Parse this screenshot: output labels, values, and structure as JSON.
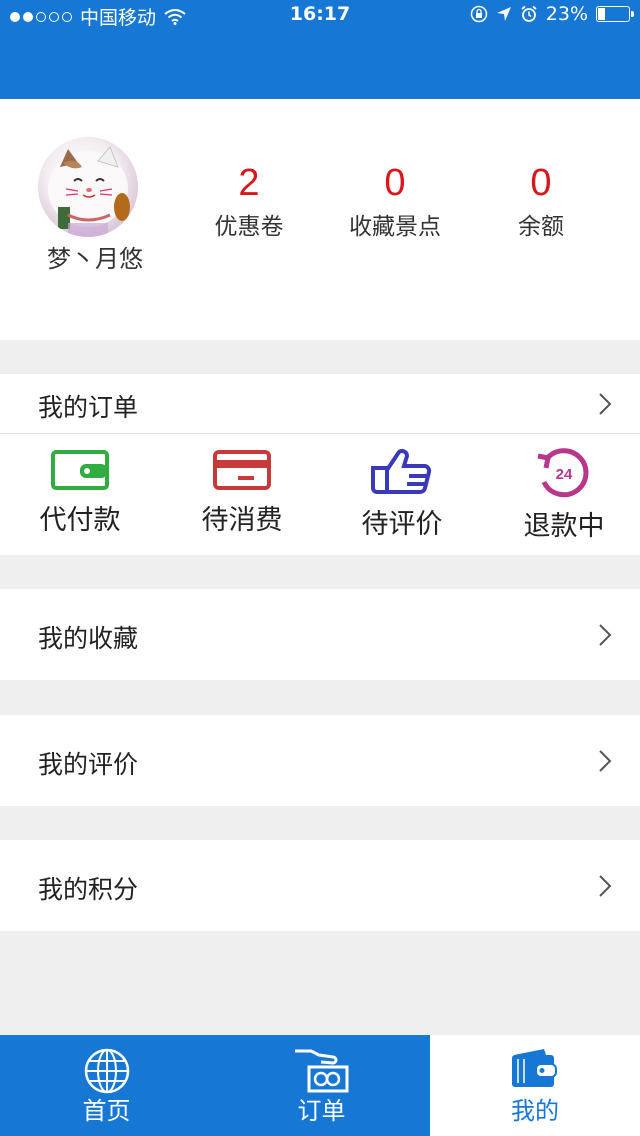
{
  "status_bar": {
    "carrier": "中国移动",
    "time": "16:17",
    "battery_percent_text": "23%",
    "battery_level": 0.23
  },
  "profile": {
    "username": "梦丶月悠",
    "stats": [
      {
        "value": "2",
        "label": "优惠卷"
      },
      {
        "value": "0",
        "label": "收藏景点"
      },
      {
        "value": "0",
        "label": "余额"
      }
    ]
  },
  "menu": {
    "my_orders": "我的订单",
    "my_favorites": "我的收藏",
    "my_reviews": "我的评价",
    "my_points": "我的积分"
  },
  "order_status": [
    {
      "label": "代付款",
      "icon": "wallet-icon",
      "color": "#2fae3f"
    },
    {
      "label": "待消费",
      "icon": "card-icon",
      "color": "#c8393a"
    },
    {
      "label": "待评价",
      "icon": "thumbs-up-icon",
      "color": "#3a3ab8"
    },
    {
      "label": "退款中",
      "icon": "refund-24-icon",
      "color": "#b8378a",
      "badge": "24"
    }
  ],
  "tab_bar": {
    "tabs": [
      {
        "label": "首页",
        "icon": "globe-icon"
      },
      {
        "label": "订单",
        "icon": "hand-money-icon"
      },
      {
        "label": "我的",
        "icon": "wallet-icon"
      }
    ],
    "active_index": 2
  },
  "colors": {
    "primary": "#1677d5",
    "stat_number": "#d9161b",
    "background": "#efefef"
  }
}
